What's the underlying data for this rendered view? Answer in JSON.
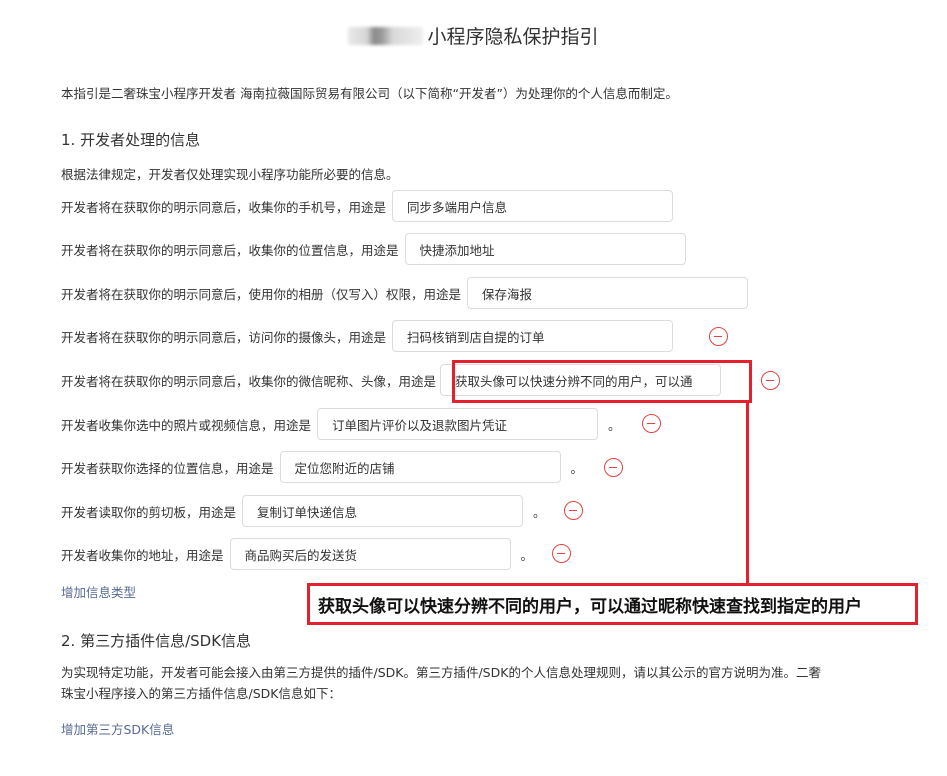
{
  "page": {
    "title": "小程序隐私保护指引",
    "intro": "本指引是二奢珠宝小程序开发者 海南拉薇国际贸易有限公司（以下简称“开发者”）为处理你的个人信息而制定。"
  },
  "section1": {
    "title": "1.  开发者处理的信息",
    "desc": "根据法律规定，开发者仅处理实现小程序功能所必要的信息。",
    "rows": [
      {
        "label": "开发者将在获取你的明示同意后，收集你的手机号，用途是",
        "value": "同步多端用户信息"
      },
      {
        "label": "开发者将在获取你的明示同意后，收集你的位置信息，用途是",
        "value": "快捷添加地址"
      },
      {
        "label": "开发者将在获取你的明示同意后，使用你的相册（仅写入）权限，用途是",
        "value": "保存海报"
      },
      {
        "label": "开发者将在获取你的明示同意后，访问你的摄像头，用途是",
        "value": "扫码核销到店自提的订单"
      },
      {
        "label": "开发者将在获取你的明示同意后，收集你的微信昵称、头像，用途是",
        "value": "获取头像可以快速分辨不同的用户，可以通"
      },
      {
        "label": "开发者收集你选中的照片或视频信息，用途是",
        "value": "订单图片评价以及退款图片凭证",
        "suffix": "。"
      },
      {
        "label": "开发者获取你选择的位置信息，用途是",
        "value": "定位您附近的店铺",
        "suffix": "。"
      },
      {
        "label": "开发者读取你的剪切板，用途是",
        "value": "复制订单快递信息",
        "suffix": "。"
      },
      {
        "label": "开发者收集你的地址，用途是",
        "value": "商品购买后的发送货",
        "suffix": "。"
      }
    ],
    "add_link": "增加信息类型"
  },
  "annotation": {
    "text": "获取头像可以快速分辨不同的用户，可以通过昵称快速查找到指定的用户",
    "color": "#e5202e"
  },
  "section2": {
    "title": "2.  第三方插件信息/SDK信息",
    "desc": "为实现特定功能，开发者可能会接入由第三方提供的插件/SDK。第三方插件/SDK的个人信息处理规则，请以其公示的官方说明为准。二奢珠宝小程序接入的第三方插件信息/SDK信息如下：",
    "add_link": "增加第三方SDK信息"
  },
  "colors": {
    "link": "#576b95",
    "delete": "#e64340",
    "highlight": "#e5202e"
  },
  "icons": {
    "delete": "minus-circle-icon"
  }
}
